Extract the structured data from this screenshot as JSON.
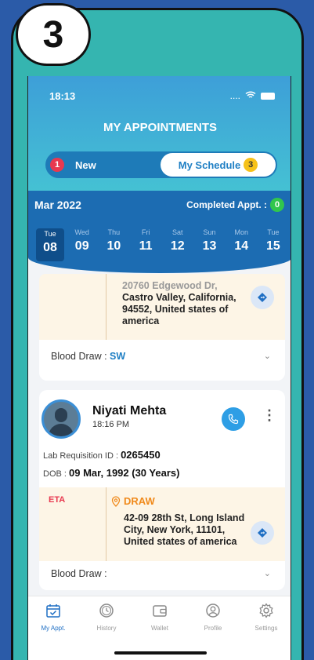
{
  "step_badge": "3",
  "status": {
    "time": "18:13",
    "signal": "....",
    "wifi": "↺"
  },
  "header": {
    "title": "MY APPOINTMENTS"
  },
  "toggle": {
    "new_count": "1",
    "new_label": "New",
    "schedule_label": "My Schedule",
    "schedule_count": "3"
  },
  "calendar": {
    "month": "Mar 2022",
    "completed_label": "Completed Appt. :",
    "completed_count": "0",
    "days": [
      {
        "wd": "Tue",
        "dn": "08",
        "selected": true
      },
      {
        "wd": "Wed",
        "dn": "09"
      },
      {
        "wd": "Thu",
        "dn": "10"
      },
      {
        "wd": "Fri",
        "dn": "11"
      },
      {
        "wd": "Sat",
        "dn": "12"
      },
      {
        "wd": "Sun",
        "dn": "13"
      },
      {
        "wd": "Mon",
        "dn": "14"
      },
      {
        "wd": "Tue",
        "dn": "15"
      }
    ]
  },
  "card1": {
    "address_line1": "20760 Edgewood Dr,",
    "address_line2": "Castro Valley, California,",
    "address_line3": "94552, United states of",
    "address_line4": "america",
    "blood_draw_label": "Blood Draw :",
    "blood_draw_code": "SW"
  },
  "card2": {
    "name": "Niyati Mehta",
    "time": "18:16 PM",
    "lab_req_label": "Lab Requisition ID :",
    "lab_req_value": "0265450",
    "dob_label": "DOB :",
    "dob_value": "09 Mar, 1992 (30 Years)",
    "eta_label": "ETA",
    "draw_label": "DRAW",
    "address_line1": "42-09 28th St, Long Island",
    "address_line2": "City, New York, 11101,",
    "address_line3": "United states of america",
    "blood_draw_label": "Blood Draw :"
  },
  "tabbar": {
    "items": [
      {
        "label": "My Appt.",
        "icon": "calendar-check-icon",
        "active": true
      },
      {
        "label": "History",
        "icon": "clock-icon"
      },
      {
        "label": "Wallet",
        "icon": "wallet-icon"
      },
      {
        "label": "Profile",
        "icon": "user-icon"
      },
      {
        "label": "Settings",
        "icon": "gear-icon"
      }
    ]
  },
  "colors": {
    "accent": "#1f6fc4",
    "header_top": "#3d9fd8",
    "header_bottom": "#45c2d3",
    "calendar_bg": "#1c6cb2",
    "address_bg": "#fdf5e6",
    "eta": "#e8384f",
    "draw": "#f08a1c"
  }
}
